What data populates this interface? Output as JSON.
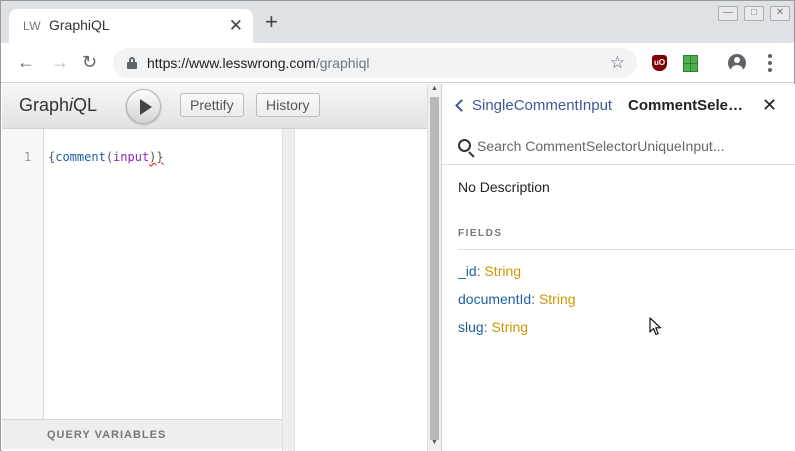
{
  "browser": {
    "tab_favicon": "LW",
    "tab_title": "GraphiQL",
    "tab_close_glyph": "✕",
    "new_tab_glyph": "+",
    "back_glyph": "←",
    "forward_glyph": "→",
    "reload_glyph": "↻",
    "url_host": "https://www.lesswrong.com",
    "url_path": "/graphiql",
    "star_glyph": "☆",
    "ublock_text": "uO"
  },
  "graphiql": {
    "title_pre": "Graph",
    "title_i": "i",
    "title_post": "QL",
    "prettify_label": "Prettify",
    "history_label": "History",
    "line_number": "1",
    "code": {
      "open_brace": "{",
      "field": "comment",
      "paren_open": "(",
      "arg": "input",
      "paren_close": ")",
      "close_brace": "}"
    },
    "query_variables_label": "QUERY VARIABLES"
  },
  "docs": {
    "back_label": "SingleCommentInput",
    "title": "CommentSelectorUniqueInput",
    "close_glyph": "✕",
    "search_placeholder": "Search CommentSelectorUniqueInput...",
    "description": "No Description",
    "fields_header": "FIELDS",
    "fields": [
      {
        "name": "_id",
        "type": "String"
      },
      {
        "name": "documentId",
        "type": "String"
      },
      {
        "name": "slug",
        "type": "String"
      }
    ]
  }
}
